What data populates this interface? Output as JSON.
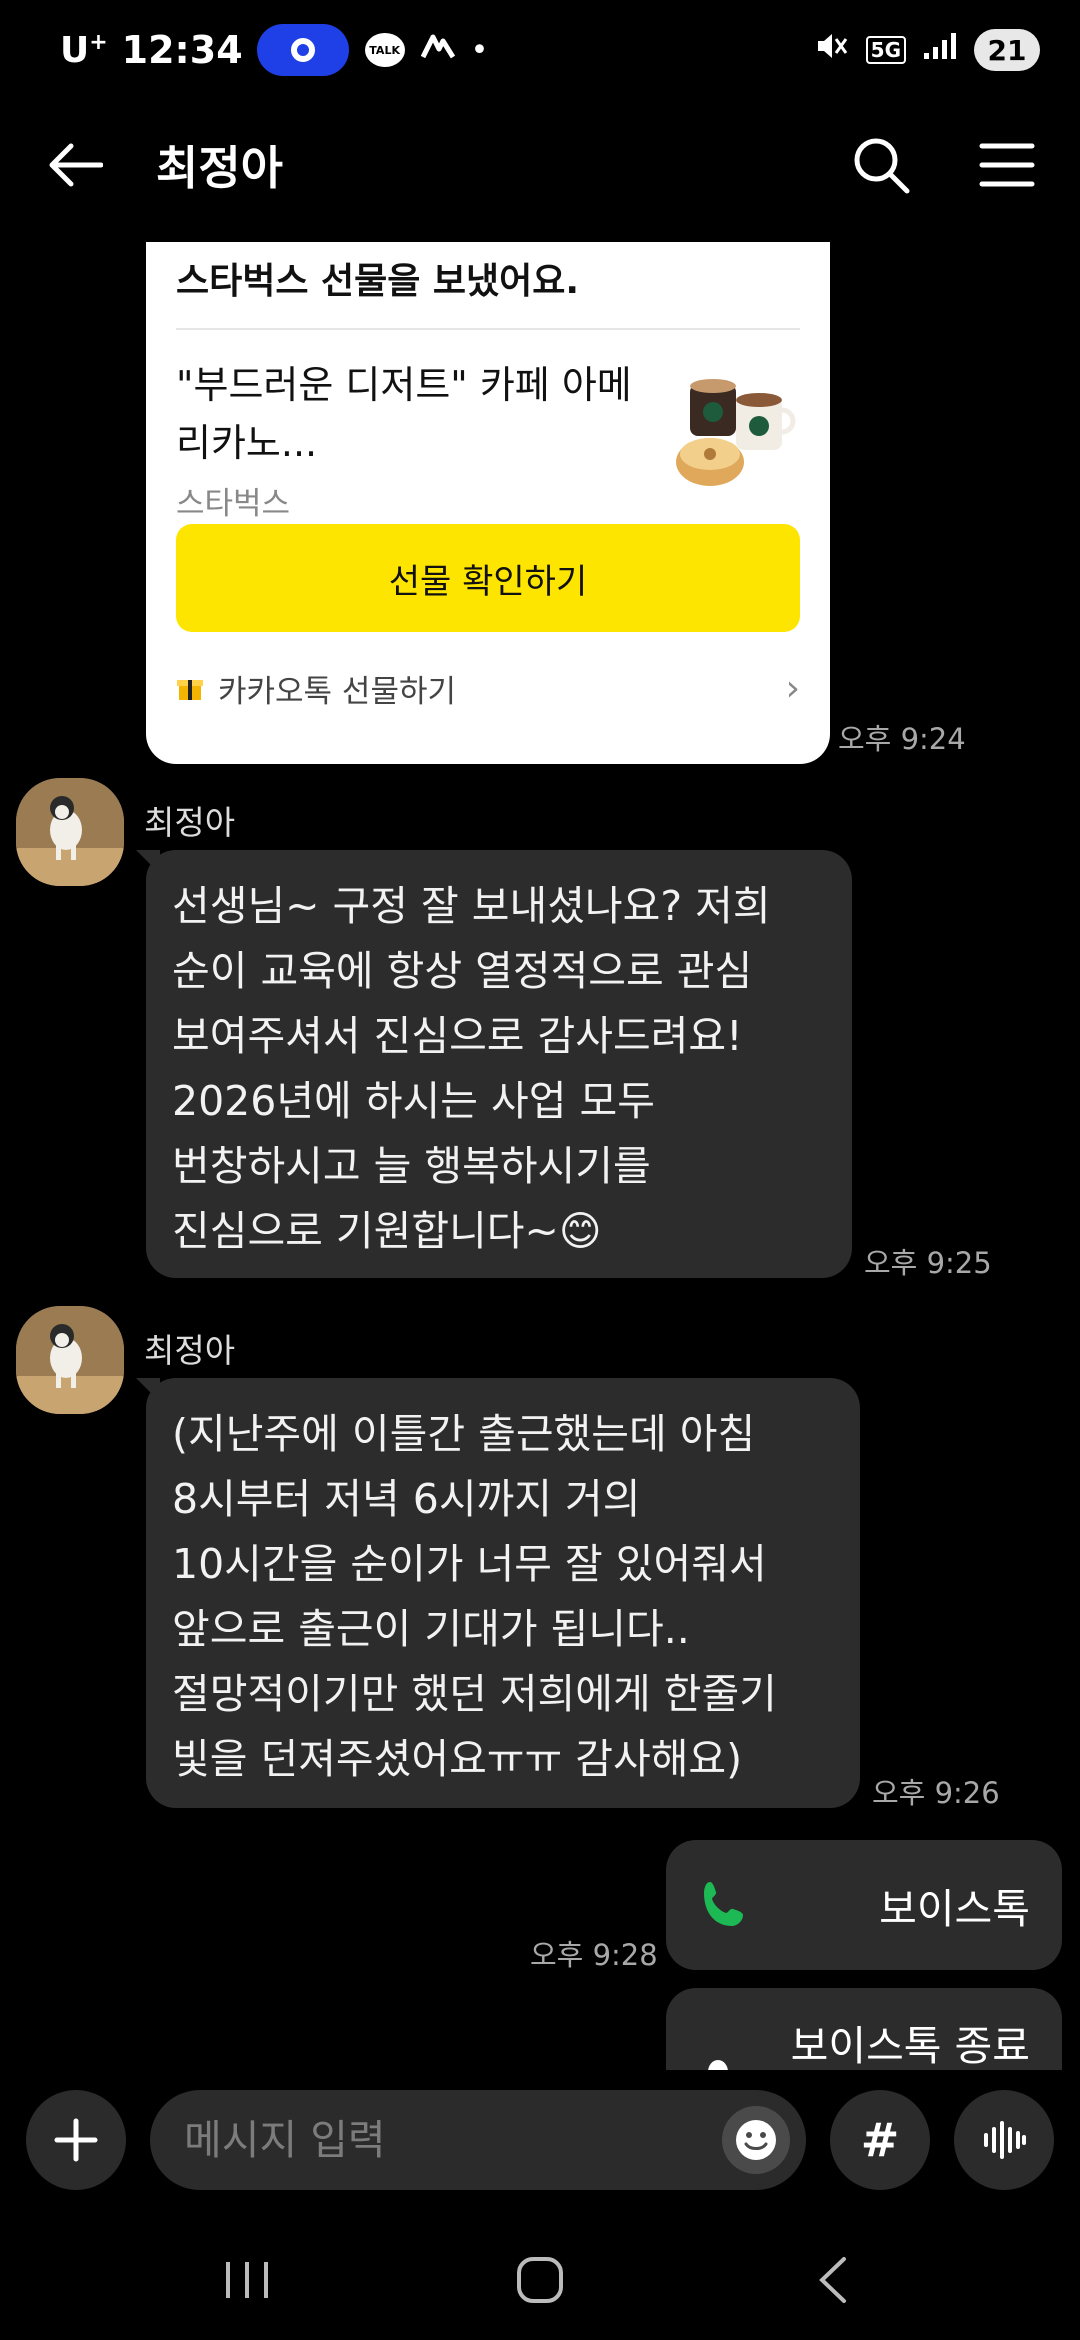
{
  "status_bar": {
    "carrier": "U",
    "carrier_sup": "+",
    "time": "12:34",
    "talk_icon_label": "TALK",
    "network": "5G",
    "battery": "21"
  },
  "header": {
    "title": "최정아"
  },
  "messages": {
    "gift": {
      "title": "스타벅스 선물을 보냈어요.",
      "product_name": "\"부드러운 디저트\" 카페 아메리카노...",
      "brand": "스타벅스",
      "button_label": "선물 확인하기",
      "footer_label": "카카오톡 선물하기",
      "time": "오후 9:24"
    },
    "msg1": {
      "sender": "최정아",
      "text": "선생님~ 구정 잘 보내셨나요? 저희\n순이 교육에 항상 열정적으로 관심\n보여주셔서 진심으로 감사드려요!\n2026년에 하시는 사업 모두\n번창하시고 늘 행복하시기를\n진심으로 기원합니다~😊",
      "time": "오후 9:25"
    },
    "msg2": {
      "sender": "최정아",
      "text": "(지난주에 이틀간 출근했는데 아침\n8시부터 저녁 6시까지 거의\n10시간을 순이가 너무 잘 있어줘서\n앞으로 출근이 기대가 됩니다..\n절망적이기만 했던 저희에게 한줄기\n빛을 던져주셨어요ㅠㅠ 감사해요)",
      "time": "오후 9:26"
    },
    "voice1": {
      "label": "보이스톡",
      "time": "오후 9:28"
    },
    "voice2": {
      "label": "보이스톡 종료"
    }
  },
  "input": {
    "placeholder": "메시지 입력",
    "hash_label": "#"
  },
  "colors": {
    "gift_button": "#fee500",
    "bubble": "#2c2c2c",
    "phone_icon": "#1db954",
    "status_pill": "#1e40e6"
  }
}
